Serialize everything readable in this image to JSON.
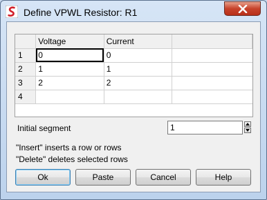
{
  "window": {
    "title": "Define VPWL Resistor: R1",
    "icon": "simetrix-logo-icon"
  },
  "grid": {
    "columns": [
      "Voltage",
      "Current"
    ],
    "rows": [
      {
        "num": "1",
        "voltage": "0",
        "current": "0"
      },
      {
        "num": "2",
        "voltage": "1",
        "current": "1"
      },
      {
        "num": "3",
        "voltage": "2",
        "current": "2"
      },
      {
        "num": "4",
        "voltage": "",
        "current": ""
      }
    ]
  },
  "initial_segment": {
    "label": "Initial segment",
    "value": "1"
  },
  "help_text": {
    "insert": "\"Insert\" inserts a row or rows",
    "delete": "\"Delete\" deletes selected rows"
  },
  "buttons": {
    "ok": "Ok",
    "paste": "Paste",
    "cancel": "Cancel",
    "help": "Help"
  }
}
